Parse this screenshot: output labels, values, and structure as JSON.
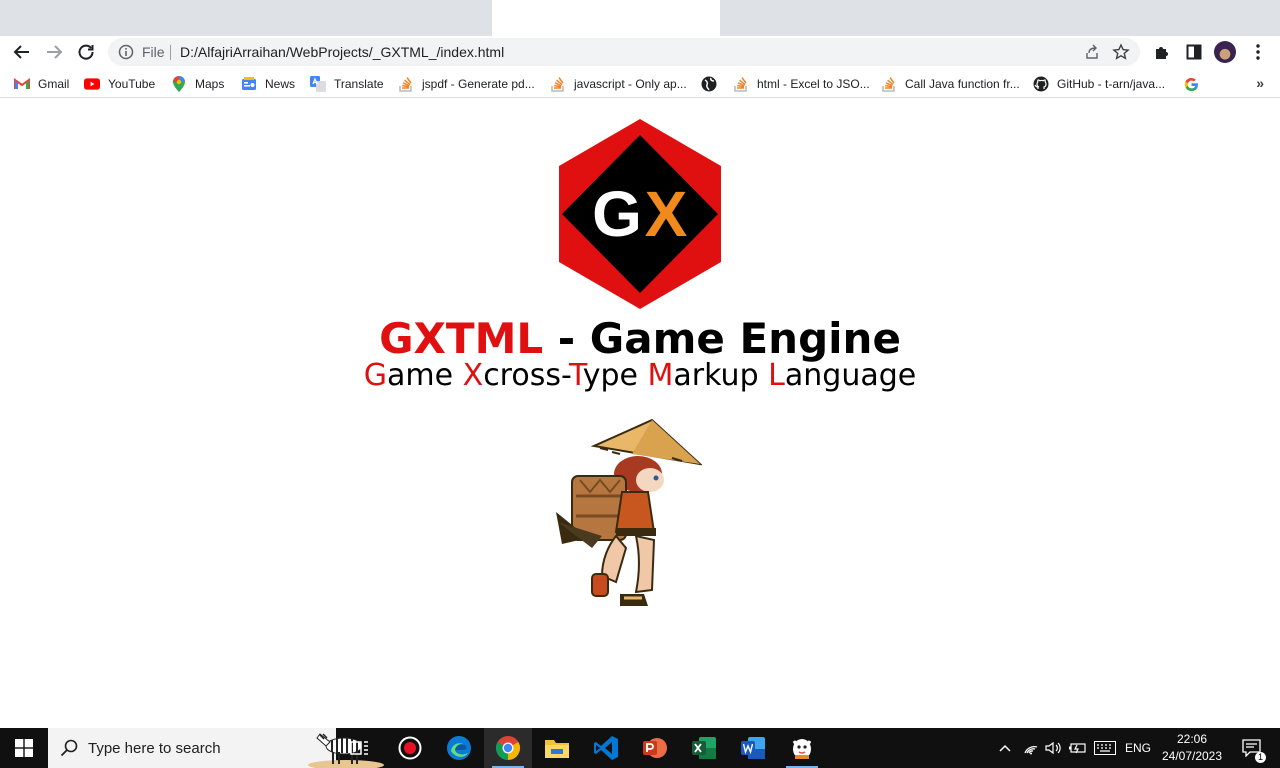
{
  "browser": {
    "address": {
      "scheme_label": "File",
      "url": "D:/AlfajriArraihan/WebProjects/_GXTML_/index.html"
    },
    "bookmarks": [
      {
        "label": "Gmail",
        "icon": "gmail-icon"
      },
      {
        "label": "YouTube",
        "icon": "youtube-icon"
      },
      {
        "label": "Maps",
        "icon": "maps-icon"
      },
      {
        "label": "News",
        "icon": "news-icon"
      },
      {
        "label": "Translate",
        "icon": "translate-icon"
      },
      {
        "label": "jspdf - Generate pd...",
        "icon": "stackoverflow-icon"
      },
      {
        "label": "javascript - Only ap...",
        "icon": "stackoverflow-icon"
      },
      {
        "label": "",
        "icon": "globe-icon"
      },
      {
        "label": "html - Excel to JSO...",
        "icon": "stackoverflow-icon"
      },
      {
        "label": "Call Java function fr...",
        "icon": "stackoverflow-icon"
      },
      {
        "label": "GitHub - t-arn/java...",
        "icon": "github-icon"
      },
      {
        "label": "",
        "icon": "google-icon"
      }
    ],
    "bookmarks_overflow": "»"
  },
  "page": {
    "logo_letters": {
      "g": "G",
      "x": "X"
    },
    "title": {
      "highlight": "GXTML",
      "rest": " - Game Engine"
    },
    "subtitle": [
      {
        "first": "G",
        "rest": "ame "
      },
      {
        "first": "X",
        "rest": "cross-"
      },
      {
        "first": "T",
        "rest": "ype "
      },
      {
        "first": "M",
        "rest": "arkup "
      },
      {
        "first": "L",
        "rest": "anguage"
      }
    ]
  },
  "taskbar": {
    "search_placeholder": "Type here to search",
    "language": "ENG",
    "time": "22:06",
    "date": "24/07/2023",
    "notification_count": "1"
  },
  "colors": {
    "accent_red": "#e01010",
    "logo_orange": "#f08a1c",
    "taskbar": "#101010"
  }
}
